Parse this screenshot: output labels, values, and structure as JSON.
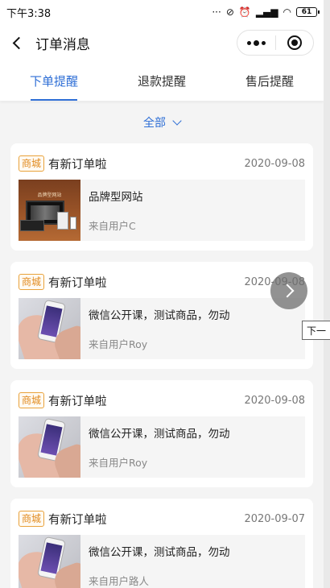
{
  "status_bar": {
    "time": "下午3:38",
    "battery": "61"
  },
  "nav": {
    "title": "订单消息"
  },
  "tabs": [
    {
      "label": "下单提醒",
      "active": true
    },
    {
      "label": "退款提醒",
      "active": false
    },
    {
      "label": "售后提醒",
      "active": false
    }
  ],
  "filter": {
    "label": "全部"
  },
  "colors": {
    "accent": "#2f6fd6",
    "badge": "#e9a23b"
  },
  "orders": [
    {
      "badge": "商城",
      "title": "有新订单啦",
      "date": "2020-09-08",
      "product": "品牌型网站",
      "from": "来自用户C",
      "thumb_label": "品牌型网站"
    },
    {
      "badge": "商城",
      "title": "有新订单啦",
      "date": "2020-09-08",
      "product": "微信公开课，测试商品，勿动",
      "from": "来自用户Roy"
    },
    {
      "badge": "商城",
      "title": "有新订单啦",
      "date": "2020-09-08",
      "product": "微信公开课，测试商品，勿动",
      "from": "来自用户Roy"
    },
    {
      "badge": "商城",
      "title": "有新订单啦",
      "date": "2020-09-07",
      "product": "微信公开课，测试商品，勿动",
      "from": "来自用户路人"
    }
  ],
  "overlay": {
    "tooltip": "下一"
  }
}
